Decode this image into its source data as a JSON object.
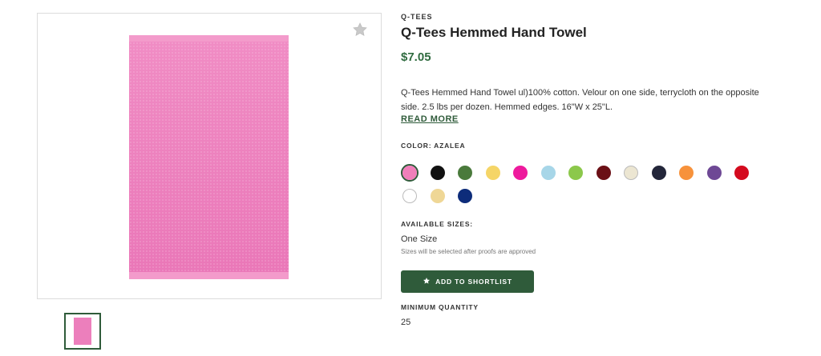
{
  "product": {
    "brand": "Q-TEES",
    "title": "Q-Tees Hemmed Hand Towel",
    "price": "$7.05",
    "description": "Q-Tees Hemmed Hand Towel ul)100% cotton. Velour on one side, terrycloth on the opposite side. 2.5 lbs per dozen. Hemmed edges. 16\"W x 25\"L.",
    "read_more_label": "READ MORE"
  },
  "colors": {
    "label": "COLOR: AZALEA",
    "selected_index": 0,
    "swatches": [
      {
        "name": "azalea",
        "hex": "#f07fba"
      },
      {
        "name": "black",
        "hex": "#111111"
      },
      {
        "name": "olive",
        "hex": "#4a7a3c"
      },
      {
        "name": "yellow",
        "hex": "#f5d567"
      },
      {
        "name": "hot pink",
        "hex": "#ee1a9d"
      },
      {
        "name": "light blue",
        "hex": "#a7d6e8"
      },
      {
        "name": "lime",
        "hex": "#8cc84b"
      },
      {
        "name": "maroon",
        "hex": "#6b1016"
      },
      {
        "name": "natural",
        "hex": "#ece6d2"
      },
      {
        "name": "navy",
        "hex": "#23263a"
      },
      {
        "name": "orange",
        "hex": "#f7923b"
      },
      {
        "name": "purple",
        "hex": "#6e4895"
      },
      {
        "name": "red",
        "hex": "#d40a1e"
      },
      {
        "name": "white",
        "hex": "#ffffff"
      },
      {
        "name": "khaki",
        "hex": "#efd796"
      },
      {
        "name": "royal",
        "hex": "#0d2c7a"
      }
    ]
  },
  "sizes": {
    "label": "AVAILABLE SIZES:",
    "value": "One Size",
    "note": "Sizes will be selected after proofs are approved"
  },
  "shortlist": {
    "label": "ADD TO SHORTLIST",
    "icon": "star-icon"
  },
  "minimum": {
    "label": "MINIMUM QUANTITY",
    "value": "25"
  },
  "theme": {
    "accent": "#2f5b3a",
    "price_color": "#2f6b3f",
    "product_color": "#ec7fbc"
  }
}
